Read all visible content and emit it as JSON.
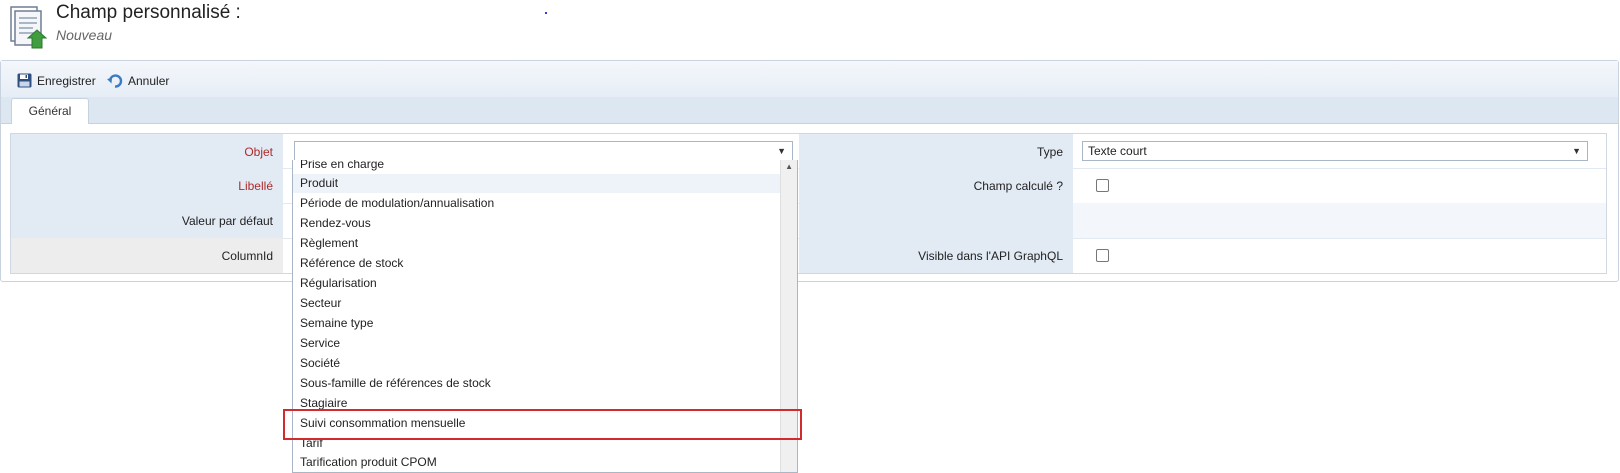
{
  "header": {
    "title": "Champ personnalisé :",
    "subtitle": "Nouveau"
  },
  "toolbar": {
    "save_label": "Enregistrer",
    "cancel_label": "Annuler"
  },
  "tabs": [
    {
      "label": "Général"
    }
  ],
  "form": {
    "objet_label": "Objet",
    "objet_value": "",
    "libelle_label": "Libellé",
    "valeur_label": "Valeur par défaut",
    "columnid_label": "ColumnId",
    "type_label": "Type",
    "type_value": "Texte court",
    "champ_calcule_label": "Champ calculé ?",
    "visible_label": "Visible dans l'API GraphQL"
  },
  "dropdown": {
    "items": [
      "Prise en charge",
      "Produit",
      "Période de modulation/annualisation",
      "Rendez-vous",
      "Règlement",
      "Référence de stock",
      "Régularisation",
      "Secteur",
      "Semaine type",
      "Service",
      "Société",
      "Sous-famille de références de stock",
      "Stagiaire",
      "Suivi consommation mensuelle",
      "Tarif",
      "Tarification produit CPOM"
    ],
    "hovered": "Produit",
    "highlighted": "Suivi consommation mensuelle"
  },
  "colors": {
    "required": "#b02a2a",
    "highlight_border": "#d22b2b",
    "label_bg": "#e2eaf4"
  },
  "icons": {
    "page": "document-arrow-icon",
    "save": "floppy-disk-icon",
    "cancel": "undo-arrow-icon"
  }
}
